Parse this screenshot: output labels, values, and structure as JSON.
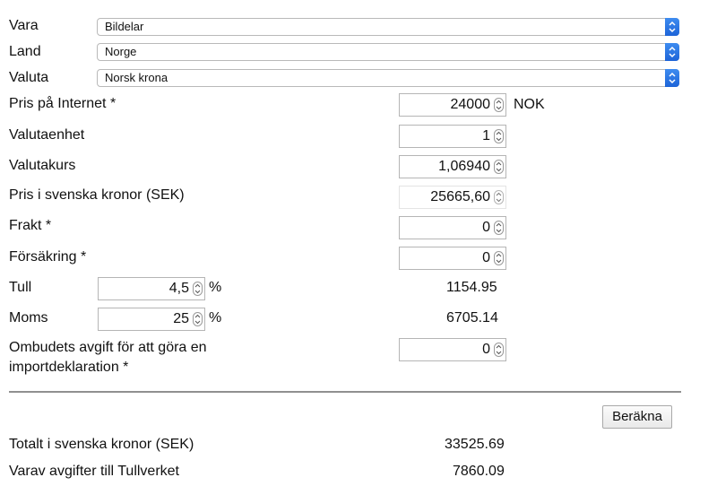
{
  "fields": {
    "vara": {
      "label": "Vara",
      "value": "Bildelar"
    },
    "land": {
      "label": "Land",
      "value": "Norge"
    },
    "valuta": {
      "label": "Valuta",
      "value": "Norsk krona"
    },
    "pris_internet": {
      "label": "Pris på Internet *",
      "value": "24000",
      "unit": "NOK"
    },
    "valutaenhet": {
      "label": "Valutaenhet",
      "value": "1"
    },
    "valutakurs": {
      "label": "Valutakurs",
      "value": "1,06940"
    },
    "pris_sek": {
      "label": "Pris i svenska kronor (SEK)",
      "value": "25665,60"
    },
    "frakt": {
      "label": "Frakt *",
      "value": "0"
    },
    "forsakring": {
      "label": "Försäkring *",
      "value": "0"
    },
    "tull": {
      "label": "Tull",
      "value": "4,5",
      "unit": "%",
      "result": "1154.95"
    },
    "moms": {
      "label": "Moms",
      "value": "25",
      "unit": "%",
      "result": "6705.14"
    },
    "ombud": {
      "label_line1": "Ombudets avgift för att göra en",
      "label_line2": "importdeklaration *",
      "value": "0"
    }
  },
  "actions": {
    "calculate_label": "Beräkna"
  },
  "totals": {
    "total_sek": {
      "label": "Totalt i svenska kronor (SEK)",
      "value": "33525.69"
    },
    "avgifter": {
      "label": "Varav avgifter till Tullverket",
      "value": "7860.09"
    }
  },
  "colors": {
    "select_arrow": "#2a74e6"
  }
}
